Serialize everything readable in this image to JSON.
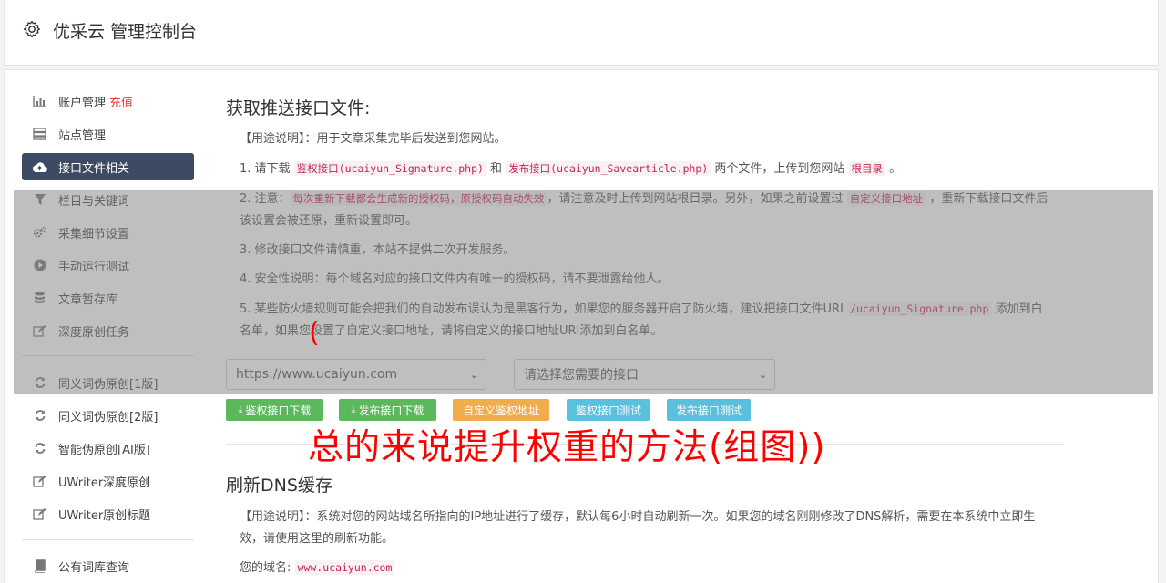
{
  "header": {
    "title": "优采云 管理控制台"
  },
  "sidebar": {
    "items": [
      {
        "label": "账户管理",
        "extra": "充值"
      },
      {
        "label": "站点管理"
      },
      {
        "label": "接口文件相关"
      },
      {
        "label": "栏目与关键词"
      },
      {
        "label": "采集细节设置"
      },
      {
        "label": "手动运行测试"
      },
      {
        "label": "文章暂存库"
      },
      {
        "label": "深度原创任务"
      },
      {
        "label": "同义词伪原创[1版]"
      },
      {
        "label": "同义词伪原创[2版]"
      },
      {
        "label": "智能伪原创[AI版]"
      },
      {
        "label": "UWriter深度原创"
      },
      {
        "label": "UWriter原创标题"
      },
      {
        "label": "公有词库查询"
      }
    ]
  },
  "section1": {
    "title": "获取推送接口文件:",
    "usage": "【用途说明】：用于文章采集完毕后发送到您网站。",
    "step1": {
      "a": "1. 请下载 ",
      "c1": "鉴权接口(ucaiyun_Signature.php)",
      "b": " 和 ",
      "c2": "发布接口(ucaiyun_Savearticle.php)",
      "c": " 两个文件，上传到您网站 ",
      "c3": "根目录",
      "d": " 。"
    },
    "step2": {
      "a": "2. 注意：",
      "c1": "每次重新下载都会生成新的授权码，原授权码自动失效",
      "b": "，请注意及时上传到网站根目录。另外，如果之前设置过 ",
      "c2": "自定义接口地址",
      "c": " ，重新下载接口文件后该设置会被还原，重新设置即可。"
    },
    "step3": "3. 修改接口文件请慎重，本站不提供二次开发服务。",
    "step4": "4. 安全性说明：每个域名对应的接口文件内有唯一的授权码，请不要泄露给他人。",
    "step5": {
      "a": "5. 某些防火墙规则可能会把我们的自动发布误认为是黑客行为，如果您的服务器开启了防火墙，建议把接口文件URI ",
      "c1": "/ucaiyun_Signature.php",
      "b": " 添加到白名单，如果您设置了自定义接口地址，请将自定义的接口地址URI添加到白名单。"
    },
    "site_select": "https://www.ucaiyun.com",
    "api_select": "请选择您需要的接口",
    "buttons": [
      {
        "label": "鉴权接口下载",
        "color": "#5cb85c"
      },
      {
        "label": "发布接口下载",
        "color": "#5cb85c"
      },
      {
        "label": "自定义鉴权地址",
        "color": "#f0ad4e"
      },
      {
        "label": "鉴权接口测试",
        "color": "#5bc0de"
      },
      {
        "label": "发布接口测试",
        "color": "#5bc0de"
      }
    ]
  },
  "section2": {
    "title": "刷新DNS缓存",
    "usage": "【用途说明】：系统对您的网站域名所指向的IP地址进行了缓存，默认每6小时自动刷新一次。如果您的域名刚刚修改了DNS解析，需要在本系统中立即生效，请使用这里的刷新功能。",
    "domain_label": "您的域名:",
    "domain_value": "www.ucaiyun.com"
  },
  "overlay_text": "总的来说提升权重的方法(组图))",
  "overlay_paren": "("
}
